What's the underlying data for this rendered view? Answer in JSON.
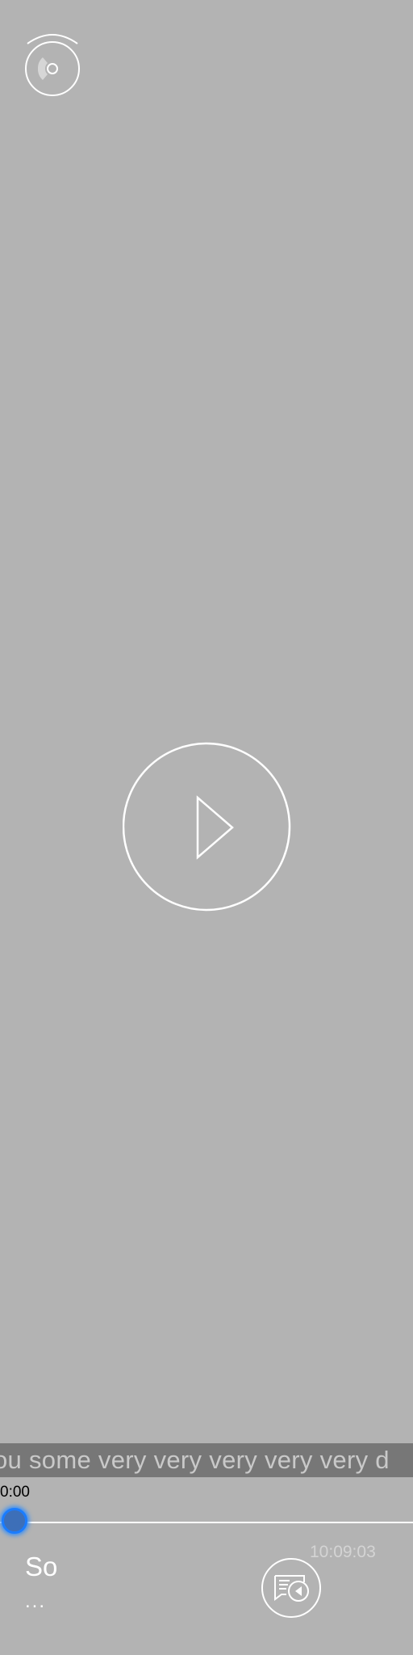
{
  "player": {
    "lyric_line": "ou some very very very very very d",
    "current_time": "0:00",
    "total_time": "10:09:03",
    "progress": 0,
    "track_title": "So",
    "track_subtitle": "..."
  },
  "icons": {
    "disc": "disc-icon",
    "play": "play-icon",
    "queue": "queue-music-icon"
  },
  "colors": {
    "background": "#b3b3b3",
    "lyric_bar": "#777777",
    "accent": "#1a7cff"
  }
}
